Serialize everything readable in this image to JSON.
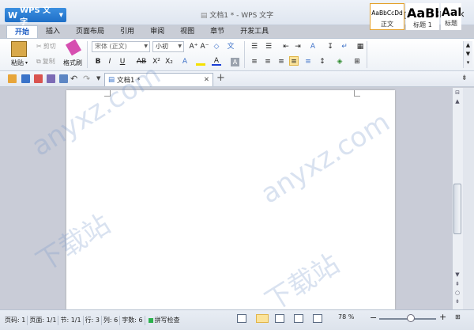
{
  "app": {
    "name": "WPS 文字",
    "window_title": "文档1 * - WPS 文字"
  },
  "tabs": [
    "开始",
    "插入",
    "页面布局",
    "引用",
    "审阅",
    "视图",
    "章节",
    "开发工具"
  ],
  "ribbon": {
    "paste": "粘贴",
    "cut": "剪切",
    "copy": "复制",
    "format_painter": "格式刷",
    "font": "宋体 (正文)",
    "size": "小初",
    "styles": [
      {
        "sample": "AaBbCcDd",
        "name": "正文"
      },
      {
        "sample": "AaBb",
        "name": "标题 1"
      },
      {
        "sample": "AaB",
        "name": "标题"
      }
    ]
  },
  "document_tab": {
    "name": "文档1 *"
  },
  "status": {
    "page": "页码: 1",
    "pages": "页面: 1/1",
    "section": "节: 1/1",
    "row": "行: 3",
    "col": "列: 6",
    "chars": "字数: 6",
    "spell": "拼写检查",
    "zoom": "78 %",
    "zoom_level": 0.55
  },
  "watermark": "anyxz.com 下载站",
  "colors": {
    "accent": "#1f6fc7",
    "active_tab": "#1f5ec4",
    "spell_ok": "#2bb24c"
  }
}
